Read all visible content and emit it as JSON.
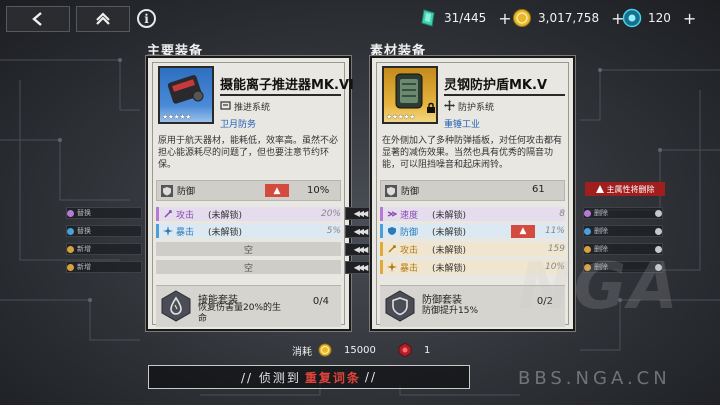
{
  "top_bar": {
    "resources": [
      {
        "icon": "energy-crystal-icon",
        "value": "31/445"
      },
      {
        "icon": "gold-coin-icon",
        "value": "3,017,758"
      },
      {
        "icon": "cyan-core-icon",
        "value": "120"
      }
    ],
    "plus": "+",
    "info": "i"
  },
  "sections": {
    "main_equipment": "主要装备",
    "material_equipment": "素材装备"
  },
  "main_card": {
    "name": "摄能离子推进器MK.VI",
    "type": "推进系统",
    "maker": "卫月防务",
    "stars": "★★★★★",
    "description": "原用于航天器材，能耗低，效率高。虽然不必担心能源耗尽的问题了，但也要注意节约环保。",
    "main_stat": {
      "name": "防御",
      "badge": "▲",
      "value": "10%"
    },
    "sub_stats": [
      {
        "name": "攻击",
        "lock": "(未解锁)",
        "value": "20%",
        "color": "#b47ad6"
      },
      {
        "name": "暴击",
        "lock": "(未解锁)",
        "value": "5%",
        "color": "#4aa0d8"
      }
    ],
    "empty_slots": [
      "空",
      "空"
    ],
    "set": {
      "name": "接能套装",
      "effect": "恢复伤害量20%的生命",
      "count": "0/4"
    }
  },
  "material_card": {
    "name": "灵钢防护盾MK.V",
    "type": "防护系统",
    "maker": "重锤工业",
    "stars": "★★★★★",
    "description": "在外侧加入了多种防弹插板，对任何攻击都有显著的减伤效果。当然也具有优秀的隔音功能，可以阻挡噪音和起床闹铃。",
    "main_stat": {
      "name": "防御",
      "value": "61"
    },
    "sub_stats": [
      {
        "name": "速度",
        "lock": "(未解锁)",
        "value": "8",
        "color": "#b47ad6",
        "badge": ""
      },
      {
        "name": "防御",
        "lock": "(未解锁)",
        "value": "11%",
        "color": "#4aa0d8",
        "badge": "▲"
      },
      {
        "name": "攻击",
        "lock": "(未解锁)",
        "value": "159",
        "color": "#e0a93a",
        "badge": ""
      },
      {
        "name": "暴击",
        "lock": "(未解锁)",
        "value": "10%",
        "color": "#e0a93a",
        "badge": ""
      }
    ],
    "set": {
      "name": "防御套装",
      "effect": "防御提升15%",
      "count": "0/2"
    }
  },
  "side_left": [
    "替换",
    "替换",
    "新增",
    "新增"
  ],
  "side_right_alert": "主属性将删除",
  "side_right": [
    "删除",
    "删除",
    "删除",
    "删除"
  ],
  "cost": {
    "label": "消耗",
    "gold": "15000",
    "item_count": "1"
  },
  "detect_bar": {
    "prefix": "// 侦测到",
    "highlight": "重复词条",
    "suffix": "//"
  },
  "watermark": {
    "logo": "NGA",
    "url": "BBS.NGA.CN"
  },
  "colors": {
    "panel_bg": "#e9e7e2",
    "accent_red": "#e0443c",
    "maker_blue": "#2260b5",
    "thumb_blue": "#2f6fc0",
    "thumb_gold": "#e8b640"
  }
}
